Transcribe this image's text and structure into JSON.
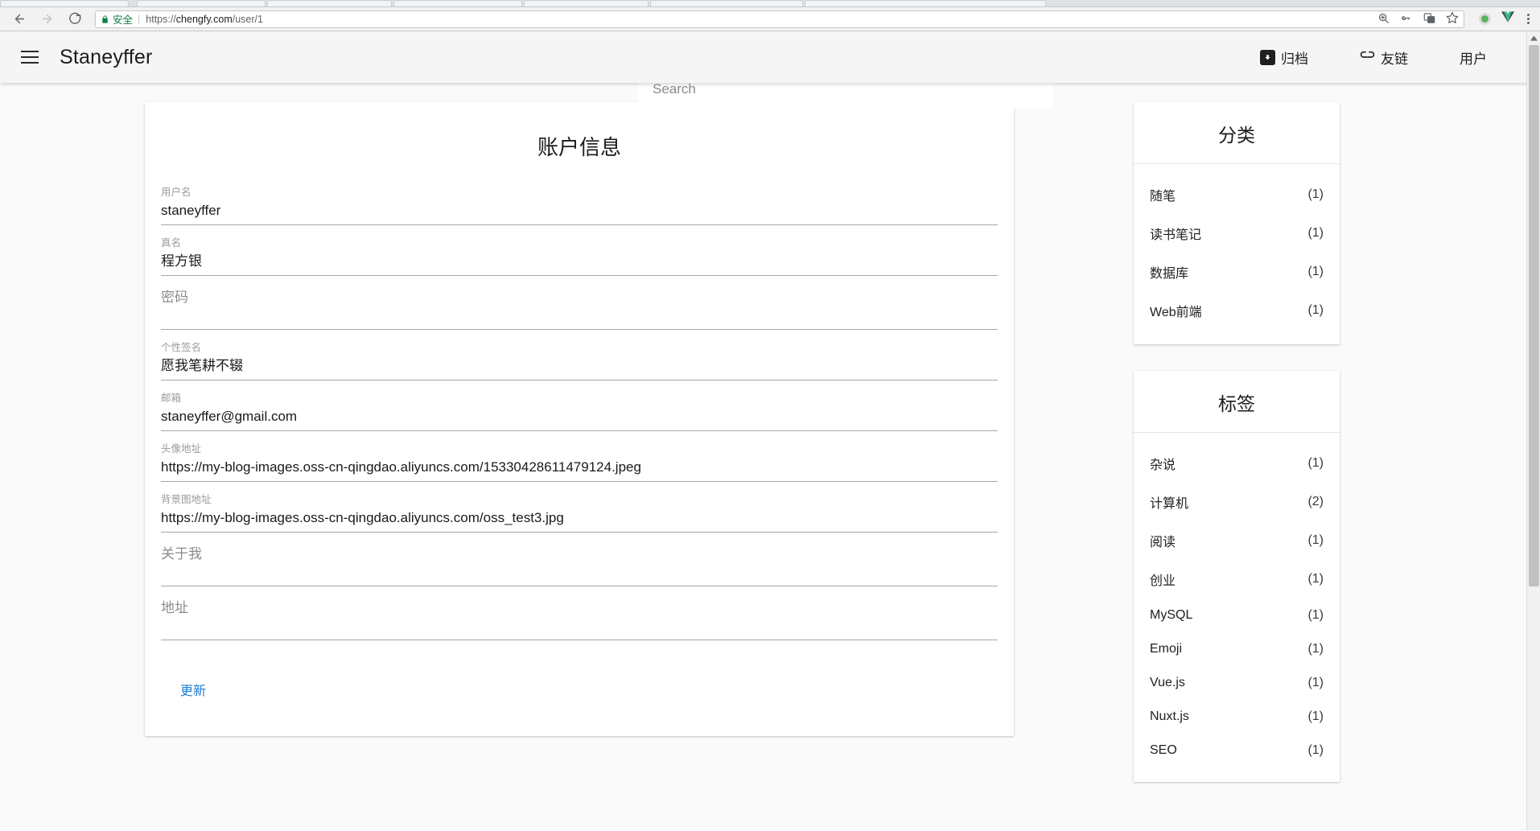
{
  "browser": {
    "back_icon": "back-arrow-icon",
    "forward_icon": "forward-arrow-icon",
    "reload_icon": "reload-icon",
    "secure_label": "安全",
    "url_scheme": "https://",
    "url_host": "chengfy.com",
    "url_path": "/user/1",
    "omnibox_actions": [
      "zoom-icon",
      "password-key-icon",
      "translate-icon",
      "bookmark-star-icon"
    ],
    "extensions": [
      "green-dot-extension-icon",
      "vuejs-devtools-icon"
    ],
    "menu_icon": "three-dot-menu-icon"
  },
  "site": {
    "brand": "Staneyffer",
    "menu_icon": "hamburger-menu-icon",
    "search": {
      "placeholder": "Search",
      "value": ""
    },
    "nav": [
      {
        "label": "归档",
        "icon": "archive-box-icon"
      },
      {
        "label": "友链",
        "icon": "link-chain-icon"
      },
      {
        "label": "用户",
        "icon": ""
      }
    ]
  },
  "account_form": {
    "title": "账户信息",
    "fields": [
      {
        "label": "用户名",
        "value": "staneyffer"
      },
      {
        "label": "真名",
        "value": "程方银"
      },
      {
        "label": "密码",
        "value": ""
      },
      {
        "label": "个性签名",
        "value": "愿我笔耕不辍"
      },
      {
        "label": "邮箱",
        "value": "staneyffer@gmail.com"
      },
      {
        "label": "头像地址",
        "value": "https://my-blog-images.oss-cn-qingdao.aliyuncs.com/15330428611479124.jpeg"
      },
      {
        "label": "背景图地址",
        "value": "https://my-blog-images.oss-cn-qingdao.aliyuncs.com/oss_test3.jpg"
      },
      {
        "label": "关于我",
        "value": ""
      },
      {
        "label": "地址",
        "value": ""
      }
    ],
    "submit_label": "更新",
    "submit_color": "#1d7fd4"
  },
  "sidebar": {
    "panels": [
      {
        "title": "分类",
        "rows": [
          {
            "label": "随笔",
            "count": "(1)"
          },
          {
            "label": "读书笔记",
            "count": "(1)"
          },
          {
            "label": "数据库",
            "count": "(1)"
          },
          {
            "label": "Web前端",
            "count": "(1)"
          }
        ]
      },
      {
        "title": "标签",
        "rows": [
          {
            "label": "杂说",
            "count": "(1)"
          },
          {
            "label": "计算机",
            "count": "(2)"
          },
          {
            "label": "阅读",
            "count": "(1)"
          },
          {
            "label": "创业",
            "count": "(1)"
          },
          {
            "label": "MySQL",
            "count": "(1)"
          },
          {
            "label": "Emoji",
            "count": "(1)"
          },
          {
            "label": "Vue.js",
            "count": "(1)"
          },
          {
            "label": "Nuxt.js",
            "count": "(1)"
          },
          {
            "label": "SEO",
            "count": "(1)"
          }
        ]
      }
    ]
  }
}
